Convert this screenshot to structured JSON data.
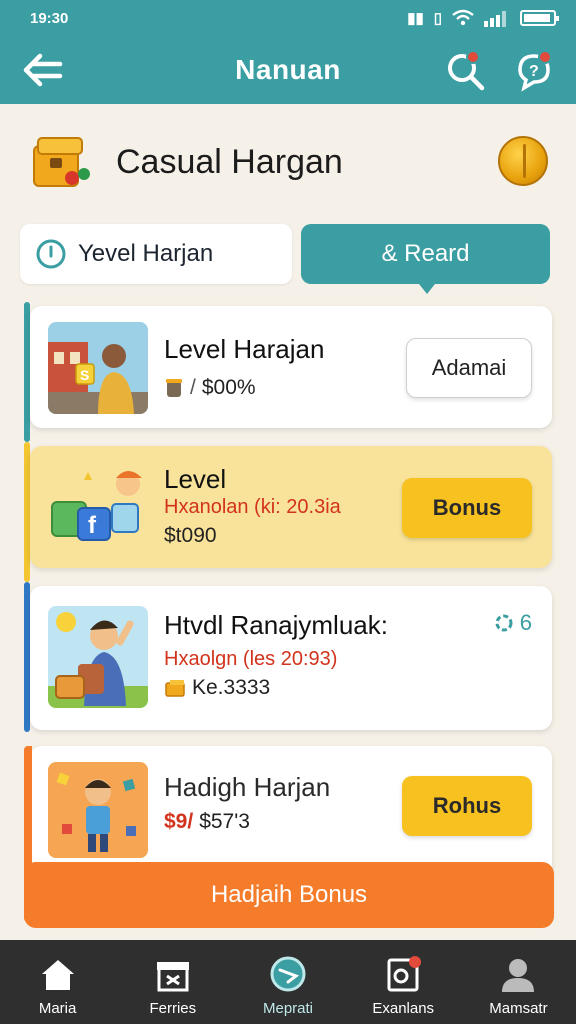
{
  "status": {
    "time": "19:30",
    "network_icon": "signal-icon"
  },
  "appbar": {
    "title": "Nanuan"
  },
  "header": {
    "title": "Casual Hargan"
  },
  "tabs": {
    "left": "Yevel Harjan",
    "right": "& Reard"
  },
  "cards": [
    {
      "title": "Level Harajan",
      "amount": "$00%",
      "button": "Adamai"
    },
    {
      "title": "Level",
      "subtitle": "Hxanolan (ki: 20.3ia",
      "amount": "$t090",
      "button": "Bonus"
    },
    {
      "title": "Htvdl Ranajymluak:",
      "subtitle": "Hxaolgn (les 20:93)",
      "amount": "Ke.3333",
      "badge": "6"
    },
    {
      "title": "Hadigh Harjan",
      "amount": "$57'3",
      "amount_prefix": "$9/",
      "button": "Rohus"
    }
  ],
  "bonus_bar": {
    "label": "Hadjaih Bonus"
  },
  "nav": [
    {
      "label": "Maria",
      "icon": "home-icon"
    },
    {
      "label": "Ferries",
      "icon": "gift-box-icon"
    },
    {
      "label": "Meprati",
      "icon": "compass-icon"
    },
    {
      "label": "Exanlans",
      "icon": "notes-icon"
    },
    {
      "label": "Mamsatr",
      "icon": "profile-icon"
    }
  ],
  "colors": {
    "teal": "#3a9ea2",
    "yellow": "#f7c21f",
    "orange": "#f47c2a",
    "red_text": "#d2331c"
  }
}
